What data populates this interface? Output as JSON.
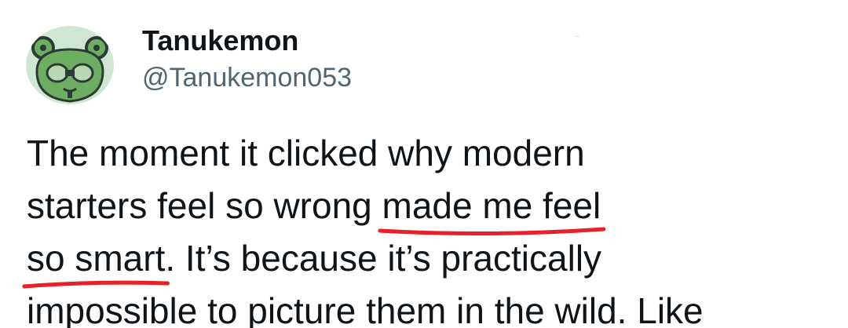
{
  "user": {
    "display_name": "Tanukemon",
    "handle": "@Tanukemon053"
  },
  "avatar": {
    "icon": "tanuki-avatar-icon",
    "bg_color": "#cfe6d2",
    "creature_color": "#6dae62",
    "outline_color": "#2c3b36"
  },
  "tweet": {
    "line1": "The moment it clicked why modern",
    "line2_a": "starters feel so wrong ",
    "line2_hl": "made me feel",
    "line3_hl": "so smart",
    "line3_b": ". It’s because it’s practically",
    "line4": "impossible to picture them in the wild. Like"
  },
  "annotation": {
    "underline_color": "#e8202a"
  }
}
